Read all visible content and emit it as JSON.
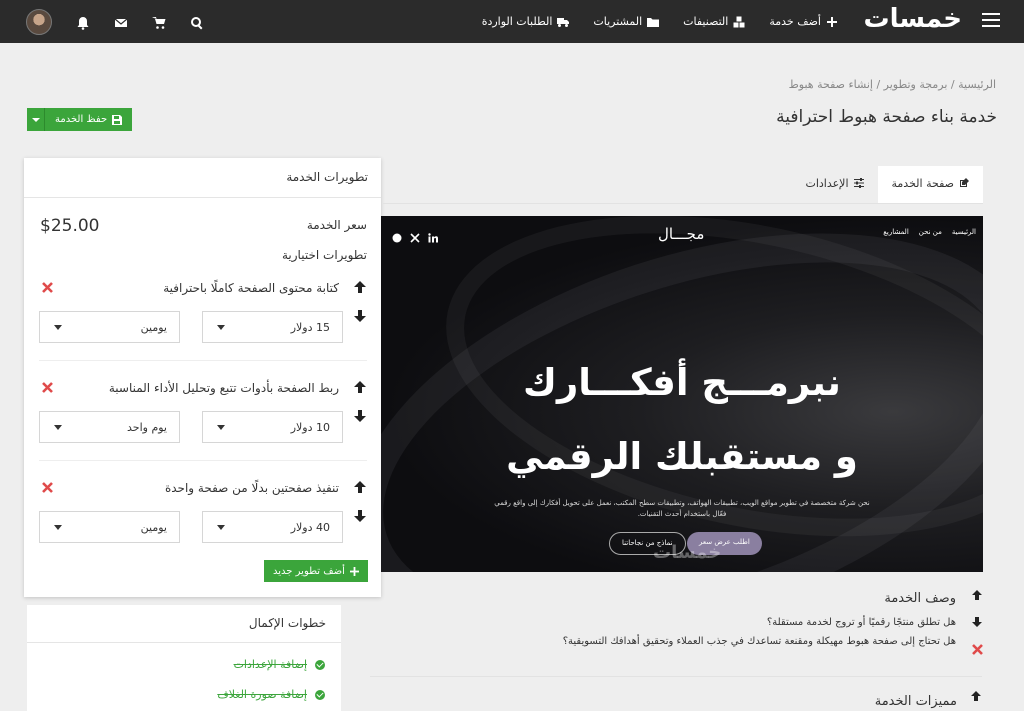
{
  "navbar": {
    "logo_text": "خمسات",
    "menu": [
      {
        "label": "أضف خدمة",
        "icon": "plus-icon"
      },
      {
        "label": "التصنيفات",
        "icon": "cubes-icon"
      },
      {
        "label": "المشتريات",
        "icon": "folder-icon"
      },
      {
        "label": "الطلبات الواردة",
        "icon": "truck-icon"
      }
    ],
    "icons": [
      "search-icon",
      "cart-icon",
      "envelope-icon",
      "bell-icon",
      "avatar"
    ],
    "colors": {
      "background": "#2b2b2b",
      "logo_accent": "#f5a623"
    }
  },
  "breadcrumb": {
    "items": [
      "الرئيسية",
      "برمجة وتطوير",
      "إنشاء صفحة هبوط"
    ],
    "separator": "/"
  },
  "page_title": "خدمة بناء صفحة هبوط احترافية",
  "save_button": {
    "label": "حفظ الخدمة",
    "icon": "save-icon",
    "color": "#3ba53b"
  },
  "upgrades_panel": {
    "title": "تطويرات الخدمة",
    "price_label": "سعر الخدمة",
    "price_value": "$25.00",
    "optional_label": "تطويرات اختيارية",
    "items": [
      {
        "title": "كتابة محتوى الصفحة كاملًا باحترافية",
        "price": "15 دولار",
        "duration": "يومين"
      },
      {
        "title": "ربط الصفحة بأدوات تتبع وتحليل الأداء المناسبة",
        "price": "10 دولار",
        "duration": "يوم واحد"
      },
      {
        "title": "تنفيذ صفحتين بدلًا من صفحة واحدة",
        "price": "40 دولار",
        "duration": "يومين"
      }
    ],
    "add_button": "أضف تطوير جديد"
  },
  "steps_panel": {
    "title": "خطوات الإكمال",
    "steps": [
      {
        "label": "إضافة الإعدادات",
        "done": true
      },
      {
        "label": "إضافة صورة الغلاف",
        "done": true
      }
    ]
  },
  "tabs": [
    {
      "label": "صفحة الخدمة",
      "icon": "edit-icon",
      "active": true
    },
    {
      "label": "الإعدادات",
      "icon": "sliders-icon",
      "active": false
    }
  ],
  "hero": {
    "nav": [
      "الرئيسية",
      "من نحن",
      "المشاريع"
    ],
    "brand": "مجـــال",
    "social": [
      "linkedin-icon",
      "x-icon",
      "github-icon"
    ],
    "headline_1": "نبرمـــج أفكـــارك",
    "headline_2": "و مستقبلك الرقمي",
    "description": "نحن شركة متخصصة في تطوير مواقع الويب، تطبيقات الهواتف، وتطبيقات سطح المكتب، نعمل على تحويل أفكارك إلى واقع رقمي فعّال باستخدام أحدث التقنيات.",
    "cta_primary": "اطلب عرض سعر",
    "cta_secondary": "نماذج من نجاحاتنا",
    "watermark": "خمسات"
  },
  "description_section": {
    "title": "وصف الخدمة",
    "lines": [
      "هل تطلق منتجًا رقميًا أو تروج لخدمة مستقلة؟",
      "هل تحتاج إلى صفحة هبوط مهيكلة ومقنعة تساعدك في جذب العملاء وتحقيق أهدافك التسويقية؟"
    ]
  },
  "features_section": {
    "title": "مميزات الخدمة"
  }
}
